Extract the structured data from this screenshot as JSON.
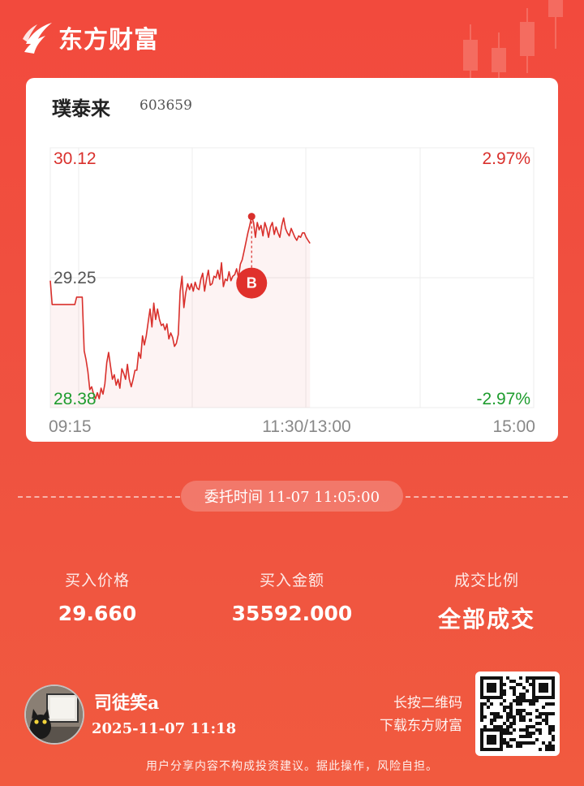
{
  "brand": {
    "name": "东方财富",
    "logo_icon": "eastmoney-logo-icon"
  },
  "stock": {
    "name": "璞泰来",
    "code": "603659"
  },
  "chart_data": {
    "type": "line",
    "y_tick_labels": {
      "top": "30.12",
      "mid": "29.25",
      "bottom": "28.38"
    },
    "pct_tick_labels": {
      "top": "2.97%",
      "bottom": "-2.97%"
    },
    "x_tick_labels": [
      "09:15",
      "11:30/13:00",
      "15:00"
    ],
    "ylim": [
      28.38,
      30.12
    ],
    "reference_price": 29.25,
    "buy_marker": {
      "label": "B",
      "price": 29.66
    },
    "series": [
      {
        "x": [
          0,
          1,
          2,
          3,
          4,
          5,
          6,
          7,
          8,
          9,
          10,
          11,
          12,
          13,
          14,
          15,
          16,
          17,
          18,
          19,
          20,
          21,
          22,
          23,
          24,
          25,
          26,
          27,
          28,
          29,
          30,
          31,
          32,
          33,
          34,
          35,
          36,
          37,
          38,
          39,
          40,
          41,
          42,
          43,
          44,
          45,
          46,
          47,
          48,
          49,
          50,
          51,
          52,
          53,
          54,
          55,
          56,
          57,
          58,
          59,
          60,
          61,
          62,
          63,
          64,
          65,
          66,
          67,
          68,
          69,
          70,
          71,
          72,
          73,
          74,
          75,
          76,
          77,
          78,
          79,
          80,
          81,
          82,
          83,
          84,
          85,
          86,
          87,
          88,
          89,
          90,
          91,
          92,
          93,
          94,
          95,
          96,
          97,
          98,
          99,
          100,
          101,
          102,
          103,
          104,
          105,
          106,
          107,
          108,
          109,
          110,
          111,
          112,
          113,
          114,
          115,
          116,
          117,
          118,
          119,
          120,
          121,
          122,
          123,
          124,
          125,
          126,
          127,
          128,
          129,
          130,
          131,
          132,
          133,
          134,
          135,
          136,
          137,
          138
        ],
        "values": [
          29.23,
          29.07,
          29.07,
          29.07,
          29.07,
          29.07,
          29.07,
          29.07,
          29.07,
          29.07,
          29.07,
          29.07,
          29.07,
          29.07,
          29.12,
          29.12,
          29.12,
          29.12,
          28.76,
          28.7,
          28.62,
          28.5,
          28.52,
          28.47,
          28.44,
          28.48,
          28.44,
          28.51,
          28.47,
          28.54,
          28.68,
          28.75,
          28.66,
          28.57,
          28.6,
          28.53,
          28.57,
          28.51,
          28.64,
          28.61,
          28.57,
          28.67,
          28.57,
          28.52,
          28.57,
          28.63,
          28.63,
          28.75,
          28.71,
          28.86,
          28.8,
          28.86,
          28.95,
          29.04,
          28.92,
          29.08,
          28.97,
          29.04,
          28.97,
          28.93,
          28.94,
          28.9,
          28.94,
          28.84,
          28.88,
          28.85,
          28.79,
          28.81,
          28.87,
          29.16,
          29.26,
          29.05,
          29.15,
          29.21,
          29.17,
          29.21,
          29.16,
          29.22,
          29.18,
          29.17,
          29.24,
          29.28,
          29.16,
          29.24,
          29.3,
          29.2,
          29.21,
          29.26,
          29.25,
          29.3,
          29.24,
          29.35,
          29.19,
          29.24,
          29.23,
          29.29,
          29.23,
          29.26,
          29.27,
          29.31,
          29.25,
          29.34,
          29.37,
          29.43,
          29.49,
          29.55,
          29.6,
          29.66,
          29.62,
          29.52,
          29.62,
          29.57,
          29.6,
          29.53,
          29.62,
          29.58,
          29.52,
          29.59,
          29.62,
          29.54,
          29.59,
          29.55,
          29.52,
          29.6,
          29.65,
          29.58,
          29.55,
          29.53,
          29.58,
          29.55,
          29.52,
          29.5,
          29.53,
          29.52,
          29.55,
          29.55,
          29.52,
          29.5,
          29.48
        ]
      }
    ]
  },
  "order": {
    "time_label": "委托时间 11-07 11:05:00"
  },
  "stats": [
    {
      "label": "买入价格",
      "value": "29.660"
    },
    {
      "label": "买入金额",
      "value": "35592.000"
    },
    {
      "label": "成交比例",
      "value": "全部成交"
    }
  ],
  "user": {
    "name": "司徒笑a",
    "time": "2025-11-07 11:18",
    "avatar_icon": "cat-avatar-icon"
  },
  "qr": {
    "hint_line1": "长按二维码",
    "hint_line2": "下载东方财富",
    "icon": "qr-code-icon"
  },
  "disclaimer": "用户分享内容不构成投资建议。据此操作，风险自担。",
  "colors": {
    "up": "#d9302c",
    "down": "#1e9c2e",
    "neutral": "#555555",
    "line": "#d9302c"
  }
}
